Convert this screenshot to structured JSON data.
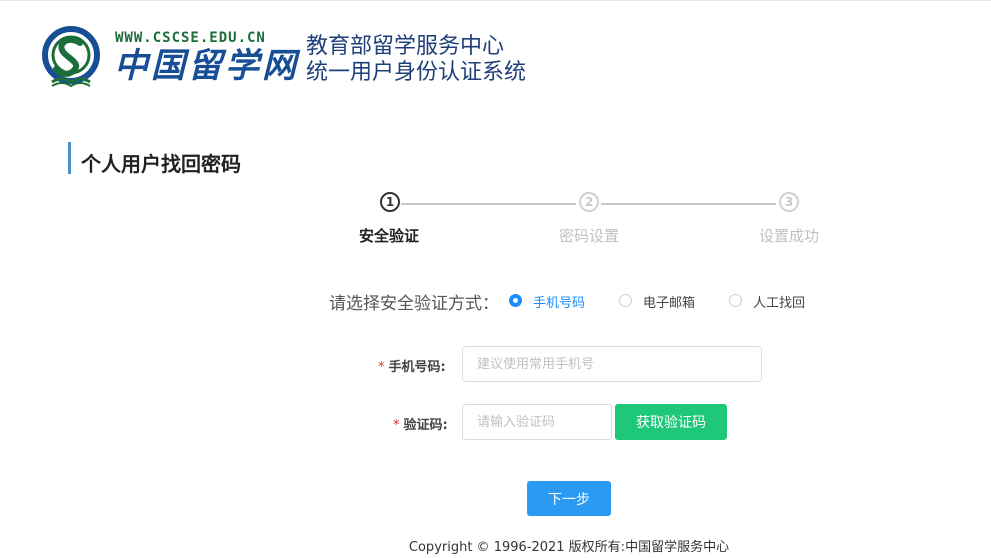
{
  "header": {
    "logo_url_text": "WWW.CSCSE.EDU.CN",
    "logo_text": "中国留学网",
    "system_line1": "教育部留学服务中心",
    "system_line2": "统一用户身份认证系统"
  },
  "page_title": "个人用户找回密码",
  "steps": [
    {
      "number": "1",
      "label": "安全验证",
      "active": true
    },
    {
      "number": "2",
      "label": "密码设置",
      "active": false
    },
    {
      "number": "3",
      "label": "设置成功",
      "active": false
    }
  ],
  "verify_method": {
    "label": "请选择安全验证方式：",
    "options": [
      {
        "label": "手机号码",
        "checked": true
      },
      {
        "label": "电子邮箱",
        "checked": false
      },
      {
        "label": "人工找回",
        "checked": false
      }
    ]
  },
  "form": {
    "phone": {
      "required_mark": "*",
      "label": "手机号码:",
      "value": "",
      "placeholder": "建议使用常用手机号"
    },
    "code": {
      "required_mark": "*",
      "label": "验证码:",
      "value": "",
      "placeholder": "请输入验证码"
    },
    "get_code_label": "获取验证码",
    "next_label": "下一步"
  },
  "footer": {
    "copyright": "Copyright © 1996-2021 版权所有:中国留学服务中心"
  },
  "colors": {
    "primary_blue": "#2b9af3",
    "radio_blue": "#1a8cff",
    "green_button": "#1ec878",
    "logo_green": "#1b6d3a",
    "logo_blue": "#184e95",
    "section_bar": "#4a90c8",
    "required_red": "#e03030"
  }
}
